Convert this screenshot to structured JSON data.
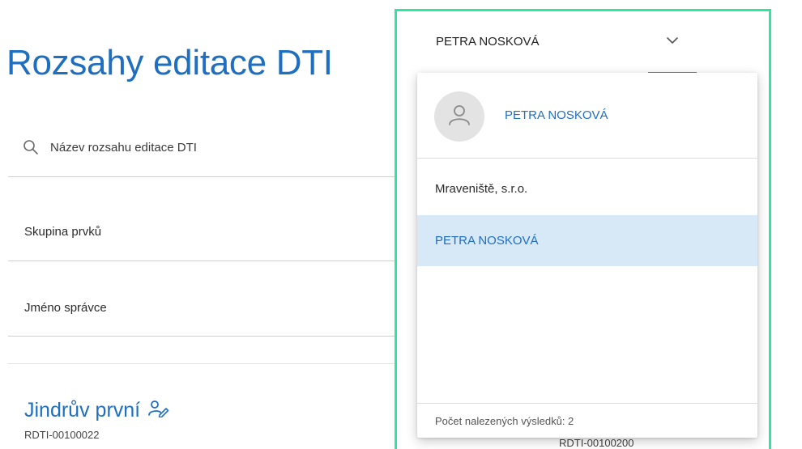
{
  "page": {
    "title": "Rozsahy editace DTI"
  },
  "search": {
    "placeholder": "Název rozsahu editace DTI"
  },
  "filters": {
    "group_label": "Skupina prvků",
    "admin_label": "Jméno správce"
  },
  "record": {
    "name": "Jindrův první",
    "id": "RDTI-00100022",
    "right_id": "RDTI-00100200",
    "icon": "user-edit-icon"
  },
  "user_select": {
    "current_user": "PETRA NOSKOVÁ",
    "icon": "chevron-down-icon"
  },
  "dropdown": {
    "header_name": "PETRA NOSKOVÁ",
    "avatar_icon": "person-icon",
    "options": [
      {
        "label": "Mraveniště, s.r.o.",
        "selected": false
      },
      {
        "label": "PETRA NOSKOVÁ",
        "selected": true
      }
    ],
    "footer": "Počet nalezených výsledků: 2"
  },
  "colors": {
    "accent": "#1f6fc1",
    "highlight": "#2ee6a0",
    "selected_bg": "#d7e8f6"
  }
}
